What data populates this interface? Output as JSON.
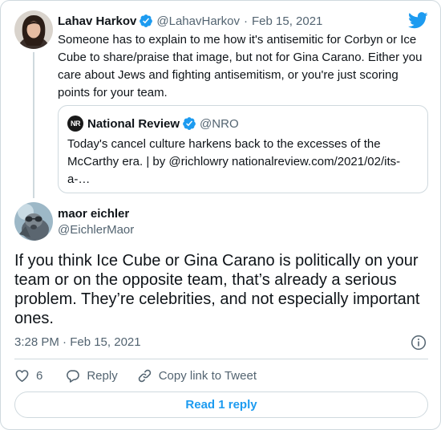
{
  "parent": {
    "name": "Lahav Harkov",
    "handle": "@LahavHarkov",
    "separator": "·",
    "date": "Feb 15, 2021",
    "text": "Someone has to explain to me how it's antisemitic for Corbyn or Ice Cube to share/praise that image, but not for Gina Carano. Either you care about Jews and fighting antisemitism, or you're just scoring points for your team.",
    "quoted": {
      "avatar_text": "NR",
      "name": "National Review",
      "handle": "@NRO",
      "text": "Today's cancel culture harkens back to the excesses of the McCarthy era. | by @richlowry nationalreview.com/2021/02/its-a-…"
    }
  },
  "tweet": {
    "name": "maor eichler",
    "handle": "@EichlerMaor",
    "text": "If you think Ice Cube or Gina Carano is politically on your team or on the opposite team, that’s already a serious problem. They’re celebrities, and not especially important ones.",
    "timestamp": "3:28 PM · Feb 15, 2021",
    "like_count": "6",
    "reply_label": "Reply",
    "copy_link_label": "Copy link to Tweet"
  },
  "read_replies_label": "Read 1 reply",
  "icons": {
    "verified": "verified-badge-icon",
    "bird": "twitter-bird-icon",
    "info": "info-icon",
    "like": "heart-icon",
    "reply": "speech-bubble-icon",
    "link": "link-icon"
  },
  "colors": {
    "accent": "#1d9bf0",
    "secondary_text": "#536471",
    "border": "#cfd9de"
  }
}
